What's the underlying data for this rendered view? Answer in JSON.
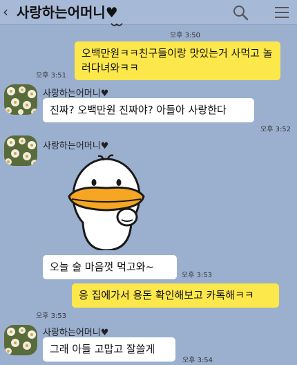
{
  "header": {
    "back_icon": "chevron-left-icon",
    "title": "사랑하는어머니♥",
    "search_icon": "search-icon",
    "menu_icon": "hamburger-menu-icon"
  },
  "colors": {
    "background": "#9bb0cf",
    "my_bubble": "#fde84b",
    "their_bubble": "#ffffff"
  },
  "messages": [
    {
      "time": "오후 3:50"
    },
    {
      "from": "me",
      "text": "오백만원ㅋㅋ친구들이랑 맛있는거 사먹고 놀러다녀와ㅋㅋ",
      "time": "오후 3:51"
    },
    {
      "from": "them",
      "sender": "사랑하는어머니♥",
      "text": "진짜? 오백만원 진짜야? 아들아 사랑한다",
      "time": "오후 3:52"
    },
    {
      "from": "them",
      "sender": "사랑하는어머니♥",
      "sticker": "duck-emoticon",
      "text": "오늘 술 마음껏 먹고와~",
      "time": "오후 3:53"
    },
    {
      "from": "me",
      "text": "응 집에가서 용돈 확인해보고 카톡해ㅋㅋ",
      "time": "오후 3:53"
    },
    {
      "from": "them",
      "sender": "사랑하는어머니♥",
      "text": "그래 아들 고맙고 잘쓸게",
      "time": "오후 3:54"
    }
  ]
}
